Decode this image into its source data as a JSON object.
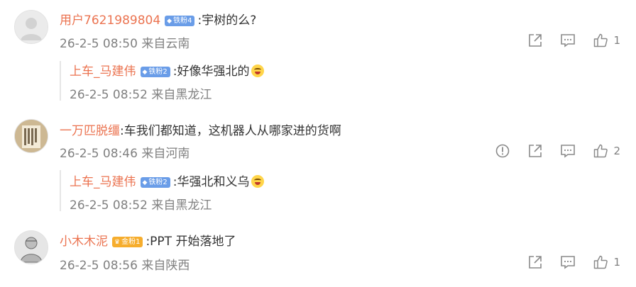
{
  "comments": [
    {
      "user": "用户7621989804",
      "badge": "铁粉4",
      "text": ":宇树的么?",
      "meta": "26-2-5 08:50 来自云南",
      "likes": "1",
      "reply": {
        "user": "上车_马建伟",
        "badge": "铁粉2",
        "text": ":好像华强北的",
        "meta": "26-2-5 08:52 来自黑龙江"
      }
    },
    {
      "user": "一万匹脱缰",
      "badge": "",
      "text": ":车我们都知道，这机器人从哪家进的货啊",
      "meta": "26-2-5 08:46 来自河南",
      "likes": "2",
      "reply": {
        "user": "上车_马建伟",
        "badge": "铁粉2",
        "text": ":华强北和义乌",
        "meta": "26-2-5 08:52 来自黑龙江"
      }
    },
    {
      "user": "小木木泥",
      "badge": "金粉1",
      "text": ":PPT 开始落地了",
      "meta": "26-2-5 08:56 来自陕西",
      "likes": "1"
    }
  ],
  "icons": {
    "share": "share-icon",
    "comment": "comment-icon",
    "like": "like-icon",
    "report": "report-icon"
  },
  "colors": {
    "username": "#eb7350",
    "meta": "#808080",
    "iron_badge": "#6a9de8",
    "gold_badge": "#f6ad2d"
  }
}
